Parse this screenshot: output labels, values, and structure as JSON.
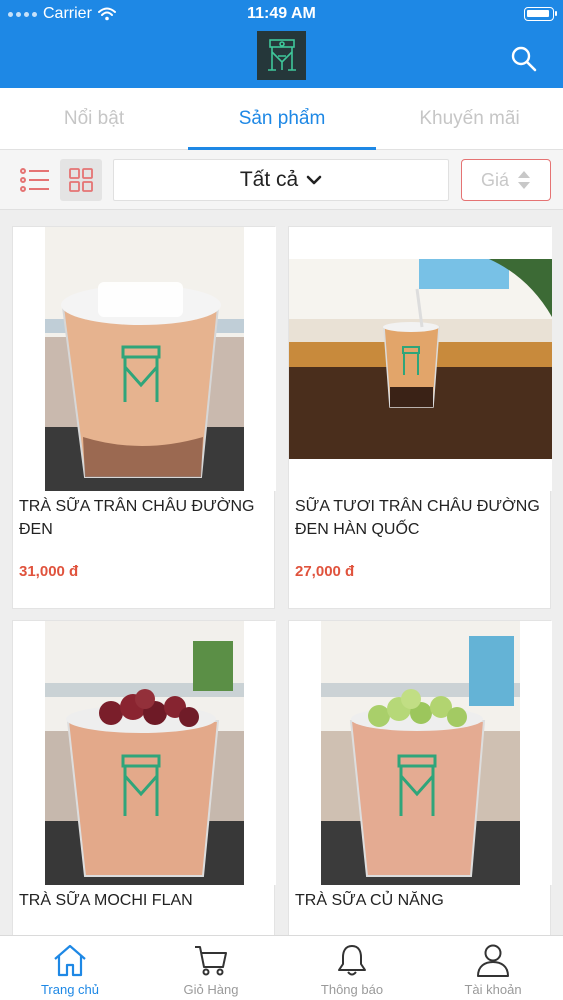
{
  "status_bar": {
    "carrier": "Carrier",
    "time": "11:49 AM"
  },
  "header": {
    "logo_icon": "brand-monogram-logo",
    "search_icon": "search-icon",
    "background": "#1e88e5"
  },
  "tabs": [
    {
      "label": "Nổi bật",
      "active": false
    },
    {
      "label": "Sản phẩm",
      "active": true
    },
    {
      "label": "Khuyến mãi",
      "active": false
    }
  ],
  "toolbar": {
    "category_filter": "Tất cả",
    "price_sort_label": "Giá"
  },
  "products": [
    {
      "name": "TRÀ SỮA TRÂN CHÂU ĐƯỜNG ĐEN",
      "price": "31,000 đ"
    },
    {
      "name": "SỮA TƯƠI TRÂN CHÂU ĐƯỜNG ĐEN HÀN QUỐC",
      "price": "27,000 đ"
    },
    {
      "name": "TRÀ SỮA MOCHI FLAN",
      "price": ""
    },
    {
      "name": "TRÀ SỮA CỦ NĂNG",
      "price": ""
    }
  ],
  "bottom_nav": [
    {
      "label": "Trang chủ",
      "icon": "home-icon",
      "active": true
    },
    {
      "label": "Giỏ Hàng",
      "icon": "cart-icon",
      "active": false
    },
    {
      "label": "Thông báo",
      "icon": "bell-icon",
      "active": false
    },
    {
      "label": "Tài khoản",
      "icon": "user-icon",
      "active": false
    }
  ],
  "colors": {
    "accent": "#1e88e5",
    "price": "#e0533d",
    "filter_icon": "#e57373"
  }
}
